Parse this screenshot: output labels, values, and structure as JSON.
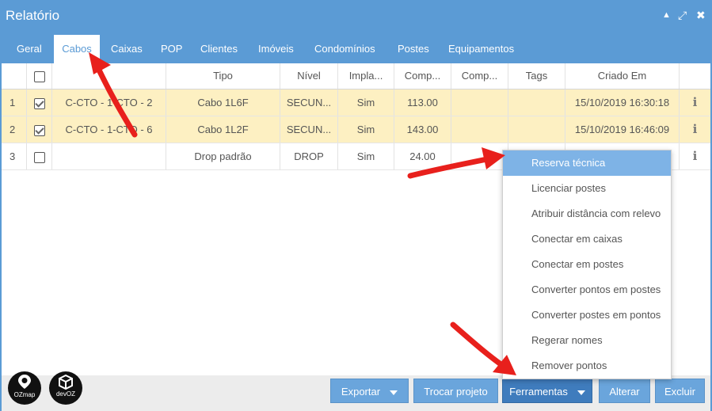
{
  "window": {
    "title": "Relatório",
    "controls": [
      "▲",
      "⤢",
      "✖"
    ]
  },
  "tabs": [
    {
      "label": "Geral",
      "active": false
    },
    {
      "label": "Cabos",
      "active": true
    },
    {
      "label": "Caixas",
      "active": false
    },
    {
      "label": "POP",
      "active": false
    },
    {
      "label": "Clientes",
      "active": false
    },
    {
      "label": "Imóveis",
      "active": false
    },
    {
      "label": "Condomínios",
      "active": false
    },
    {
      "label": "Postes",
      "active": false
    },
    {
      "label": "Equipamentos",
      "active": false
    }
  ],
  "table": {
    "columns": [
      "",
      "",
      "",
      "Tipo",
      "Nível",
      "Impla...",
      "Comp...",
      "Comp...",
      "Tags",
      "Criado Em",
      ""
    ],
    "rows": [
      {
        "num": "1",
        "checked": true,
        "name": "C-CTO - 1-CTO - 2",
        "tipo": "Cabo 1L6F",
        "nivel": "SECUN...",
        "impl": "Sim",
        "comp1": "113.00",
        "comp2": "",
        "tags": "",
        "criado": "15/10/2019 16:30:18",
        "selected": true
      },
      {
        "num": "2",
        "checked": true,
        "name": "C-CTO - 1-CTO - 6",
        "tipo": "Cabo 1L2F",
        "nivel": "SECUN...",
        "impl": "Sim",
        "comp1": "143.00",
        "comp2": "",
        "tags": "",
        "criado": "15/10/2019 16:46:09",
        "selected": true
      },
      {
        "num": "3",
        "checked": false,
        "name": "",
        "tipo": "Drop padrão",
        "nivel": "DROP",
        "impl": "Sim",
        "comp1": "24.00",
        "comp2": "",
        "tags": "",
        "criado": "",
        "selected": false
      }
    ]
  },
  "menu": {
    "items": [
      "Reserva técnica",
      "Licenciar postes",
      "Atribuir distância com relevo",
      "Conectar em caixas",
      "Conectar em postes",
      "Converter pontos em postes",
      "Converter postes em pontos",
      "Regerar nomes",
      "Remover pontos"
    ],
    "highlighted": 0
  },
  "logos": [
    {
      "label": "OZmap"
    },
    {
      "label": "devOZ"
    }
  ],
  "footer": {
    "exportar": "Exportar",
    "trocar_projeto": "Trocar projeto",
    "ferramentas": "Ferramentas",
    "alterar": "Alterar",
    "excluir": "Excluir"
  },
  "colors": {
    "accent": "#5b9bd5",
    "selected_row": "#fdf0c2",
    "menu_highlight": "#7eb3e6",
    "annotation_arrow": "#e8201c"
  },
  "icons": [
    "info-icon",
    "caret-down-icon",
    "pin-icon",
    "cube-icon"
  ]
}
